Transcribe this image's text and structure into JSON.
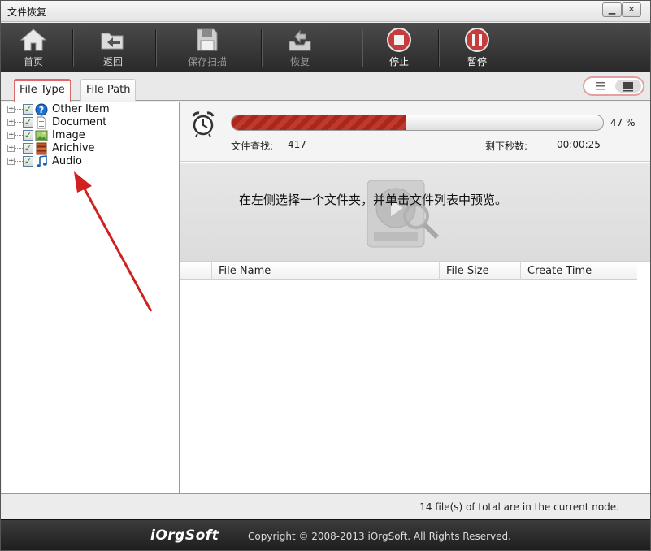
{
  "window": {
    "title": "文件恢复",
    "minimize_label": "▁",
    "close_label": "✕"
  },
  "toolbar": {
    "items": [
      {
        "label": "首页",
        "icon": "home-icon",
        "state": "normal"
      },
      {
        "label": "返回",
        "icon": "folder-back-icon",
        "state": "normal"
      },
      {
        "label": "保存扫描",
        "icon": "floppy-disk-icon",
        "state": "disabled"
      },
      {
        "label": "恢复",
        "icon": "recover-tray-icon",
        "state": "disabled"
      },
      {
        "label": "停止",
        "icon": "stop-icon",
        "state": "active"
      },
      {
        "label": "暂停",
        "icon": "pause-icon",
        "state": "active"
      }
    ]
  },
  "tabs": [
    {
      "label": "File Type",
      "active": true
    },
    {
      "label": "File Path",
      "active": false
    }
  ],
  "view_toggle": {
    "options": [
      "list-view-icon",
      "detail-view-icon"
    ],
    "selected": "detail-view-icon"
  },
  "tree": {
    "items": [
      {
        "label": "Other Item",
        "icon": "question-icon",
        "checked": true
      },
      {
        "label": "Document",
        "icon": "document-icon",
        "checked": true
      },
      {
        "label": "Image",
        "icon": "image-icon",
        "checked": true
      },
      {
        "label": "Arichive",
        "icon": "archive-icon",
        "checked": true
      },
      {
        "label": "Audio",
        "icon": "music-note-icon",
        "checked": true
      }
    ],
    "expand_symbol": "+",
    "check_symbol": "✓"
  },
  "scan": {
    "progress_percent": 47,
    "progress_text": "47 %",
    "found_label": "文件查找:",
    "found_value": "417",
    "remaining_label": "剩下秒数:",
    "remaining_value": "00:00:25"
  },
  "preview": {
    "message": "在左侧选择一个文件夹，并单击文件列表中预览。"
  },
  "file_table": {
    "columns": [
      "",
      "File Name",
      "File Size",
      "Create Time"
    ],
    "rows": []
  },
  "status": {
    "message": "14 file(s) of total are in the current node."
  },
  "footer": {
    "logo": "iOrgSoft",
    "copyright": "Copyright © 2008-2013 iOrgSoft. All Rights Reserved."
  },
  "colors": {
    "accent": "#c0392b",
    "toolbar_bg": "#333333",
    "tab_active": "#e06868"
  }
}
